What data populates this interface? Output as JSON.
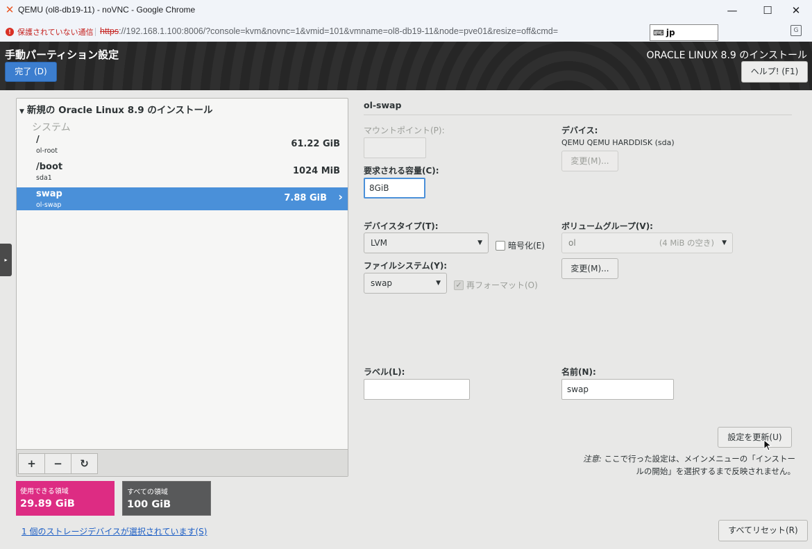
{
  "window": {
    "title": "QEMU (ol8-db19-11) - noVNC - Google Chrome",
    "minimize": "—",
    "maximize": "☐",
    "close": "✕"
  },
  "browser": {
    "security_label": "保護されていない通信",
    "url_scheme": "https",
    "url_rest": "://192.168.1.100:8006/?console=kvm&novnc=1&vmid=101&vmname=ol8-db19-11&node=pve01&resize=off&cmd=",
    "translate_icon": "translate-icon"
  },
  "header": {
    "page_title": "手動パーティション設定",
    "done_label": "完了 (D)",
    "install_title": "ORACLE LINUX 8.9 のインストール",
    "keyboard_layout": "jp",
    "help_label": "ヘルプ! (F1)"
  },
  "tree": {
    "root_label": "新規の Oracle Linux 8.9 のインストール",
    "group_label": "システム",
    "rows": [
      {
        "mount": "/",
        "device": "ol-root",
        "size": "61.22 GiB"
      },
      {
        "mount": "/boot",
        "device": "sda1",
        "size": "1024 MiB"
      },
      {
        "mount": "swap",
        "device": "ol-swap",
        "size": "7.88 GiB"
      }
    ],
    "toolbar": {
      "add": "+",
      "remove": "−",
      "refresh": "↻"
    }
  },
  "space": {
    "available_label": "使用できる領域",
    "available_value": "29.89 GiB",
    "total_label": "すべての領域",
    "total_value": "100 GiB"
  },
  "storage_link": "1 個のストレージデバイスが選択されています(S)",
  "reset_all_label": "すべてリセット(R)",
  "detail": {
    "title": "ol-swap",
    "mount_point_label": "マウントポイント(P):",
    "mount_point_value": "",
    "capacity_label": "要求される容量(C):",
    "capacity_value": "8GiB",
    "device_label": "デバイス:",
    "device_value": "QEMU QEMU HARDDISK (sda)",
    "device_change_label": "変更(M)...",
    "device_type_label": "デバイスタイプ(T):",
    "device_type_value": "LVM",
    "encrypt_label": "暗号化(E)",
    "volume_group_label": "ボリュームグループ(V):",
    "volume_group_value": "ol",
    "volume_group_free": "(4 MiB の空き)",
    "volume_group_change_label": "変更(M)...",
    "filesystem_label": "ファイルシステム(Y):",
    "filesystem_value": "swap",
    "reformat_label": "再フォーマット(O)",
    "label_label": "ラベル(L):",
    "label_value": "",
    "name_label": "名前(N):",
    "name_value": "swap",
    "update_label": "設定を更新(U)",
    "note_prefix": "注意:",
    "note_text": " ここで行った設定は、メインメニューの「インストールの開始」を選択するまで反映されません。"
  },
  "colors": {
    "selection": "#4a90d9",
    "available": "#dd2c83",
    "total": "#58595a",
    "done_button": "#3c7ecf"
  }
}
